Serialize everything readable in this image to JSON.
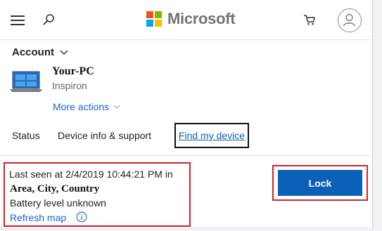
{
  "header": {
    "logo_text": "Microsoft",
    "logo_colors": [
      "#f25022",
      "#7fba00",
      "#00a4ef",
      "#ffb900"
    ]
  },
  "account": {
    "label": "Account"
  },
  "device": {
    "name": "Your-PC",
    "model": "Inspiron",
    "more_actions_label": "More actions"
  },
  "tabs": [
    {
      "label": "Status"
    },
    {
      "label": "Device info & support"
    },
    {
      "label": "Find my device",
      "selected": true
    }
  ],
  "find_device": {
    "last_seen": "Last seen at 2/4/2019 10:44:21 PM in",
    "location": "Area, City, Country",
    "battery": "Battery level unknown",
    "refresh_label": "Refresh map",
    "lock_label": "Lock"
  },
  "colors": {
    "accent_link": "#1a64c8",
    "lock_button": "#0b61b8",
    "highlight_outline": "#d6212b"
  }
}
